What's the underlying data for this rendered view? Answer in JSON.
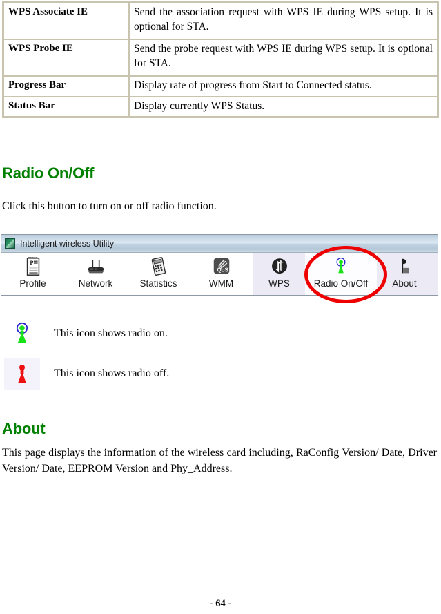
{
  "table": {
    "rows": [
      {
        "label": "WPS Associate IE",
        "description": "Send the association request with WPS IE during WPS setup. It is optional for STA.",
        "tall": true
      },
      {
        "label": "WPS Probe IE",
        "description": "Send the probe request with WPS IE during WPS setup. It is optional for STA.",
        "tall": true
      },
      {
        "label": "Progress Bar",
        "description": "Display rate of progress from Start to Connected status.",
        "tall": false
      },
      {
        "label": "Status Bar",
        "description": "Display currently WPS Status.",
        "tall": false
      }
    ]
  },
  "sections": {
    "radio": {
      "heading": "Radio On/Off",
      "paragraph": "Click this button to turn on or off radio function."
    },
    "about": {
      "heading": "About",
      "paragraph": "This page displays the information of the wireless card including, RaConfig Version/ Date, Driver Version/ Date, EEPROM Version and Phy_Address."
    }
  },
  "app_window": {
    "title": "Intelligent wireless Utility",
    "toolbar": {
      "left_group": [
        {
          "label": "Profile",
          "icon": "profile-notepad-icon"
        },
        {
          "label": "Network",
          "icon": "network-router-icon"
        },
        {
          "label": "Statistics",
          "icon": "statistics-calculator-icon"
        },
        {
          "label": "WMM",
          "icon": "wmm-qos-icon"
        }
      ],
      "right_group": [
        {
          "label": "WPS",
          "icon": "wps-arrows-icon"
        },
        {
          "label": "Radio On/Off",
          "icon": "radio-tower-green-icon"
        },
        {
          "label": "About",
          "icon": "about-satellite-icon"
        }
      ]
    }
  },
  "legend": [
    {
      "state": "on",
      "icon": "radio-on-green-tower-icon",
      "text": "This icon shows radio on."
    },
    {
      "state": "off",
      "icon": "radio-off-red-tower-icon",
      "text": "This icon shows radio off."
    }
  ],
  "footer": {
    "page_number": "- 64 -"
  },
  "colors": {
    "heading_green": "#008000",
    "annotation_red": "#ee0000",
    "table_border": "#c8c4b0",
    "radio_on_green": "#19e219",
    "radio_off_red": "#ee1111",
    "toolbar_highlight": "#eceaf4"
  }
}
